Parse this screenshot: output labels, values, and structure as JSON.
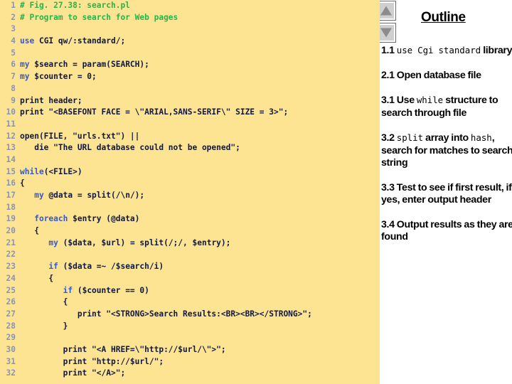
{
  "code_panel": {
    "language": "perl",
    "lines": [
      {
        "num": "1",
        "tokens": [
          {
            "t": "# Fig. 27.38: search.pl",
            "c": "comment"
          }
        ]
      },
      {
        "num": "2",
        "tokens": [
          {
            "t": "# Program to search for Web pages",
            "c": "comment"
          }
        ]
      },
      {
        "num": "3",
        "tokens": [
          {
            "t": "",
            "c": "plain"
          }
        ]
      },
      {
        "num": "4",
        "tokens": [
          {
            "t": "use",
            "c": "kw"
          },
          {
            "t": " CGI qw/:standard/;",
            "c": "plain"
          }
        ]
      },
      {
        "num": "5",
        "tokens": [
          {
            "t": "",
            "c": "plain"
          }
        ]
      },
      {
        "num": "6",
        "tokens": [
          {
            "t": "my",
            "c": "kw"
          },
          {
            "t": " $search = param(SEARCH);",
            "c": "plain"
          }
        ]
      },
      {
        "num": "7",
        "tokens": [
          {
            "t": "my",
            "c": "kw"
          },
          {
            "t": " $counter = 0;",
            "c": "plain"
          }
        ]
      },
      {
        "num": "8",
        "tokens": [
          {
            "t": "",
            "c": "plain"
          }
        ]
      },
      {
        "num": "9",
        "tokens": [
          {
            "t": "print header;",
            "c": "plain"
          }
        ]
      },
      {
        "num": "10",
        "tokens": [
          {
            "t": "print \"<BASEFONT FACE = \\\"ARIAL,SANS-SERIF\\\" SIZE = 3>\";",
            "c": "plain"
          }
        ]
      },
      {
        "num": "11",
        "tokens": [
          {
            "t": "",
            "c": "plain"
          }
        ]
      },
      {
        "num": "12",
        "tokens": [
          {
            "t": "open(FILE, \"urls.txt\") ||",
            "c": "plain"
          }
        ]
      },
      {
        "num": "13",
        "tokens": [
          {
            "t": "   die \"The URL database could not be opened\";",
            "c": "plain"
          }
        ]
      },
      {
        "num": "14",
        "tokens": [
          {
            "t": "",
            "c": "plain"
          }
        ]
      },
      {
        "num": "15",
        "tokens": [
          {
            "t": "while",
            "c": "kw"
          },
          {
            "t": "(<FILE>)",
            "c": "plain"
          }
        ]
      },
      {
        "num": "16",
        "tokens": [
          {
            "t": "{",
            "c": "plain"
          }
        ]
      },
      {
        "num": "17",
        "tokens": [
          {
            "t": "   ",
            "c": "plain"
          },
          {
            "t": "my",
            "c": "kw"
          },
          {
            "t": " @data = split(/\\n/);",
            "c": "plain"
          }
        ]
      },
      {
        "num": "18",
        "tokens": [
          {
            "t": "",
            "c": "plain"
          }
        ]
      },
      {
        "num": "19",
        "tokens": [
          {
            "t": "   ",
            "c": "plain"
          },
          {
            "t": "foreach",
            "c": "kw"
          },
          {
            "t": " $entry (@data)",
            "c": "plain"
          }
        ]
      },
      {
        "num": "20",
        "tokens": [
          {
            "t": "   {",
            "c": "plain"
          }
        ]
      },
      {
        "num": "21",
        "tokens": [
          {
            "t": "      ",
            "c": "plain"
          },
          {
            "t": "my",
            "c": "kw"
          },
          {
            "t": " ($data, $url) = split(/;/, $entry);",
            "c": "plain"
          }
        ]
      },
      {
        "num": "22",
        "tokens": [
          {
            "t": "",
            "c": "plain"
          }
        ]
      },
      {
        "num": "23",
        "tokens": [
          {
            "t": "      ",
            "c": "plain"
          },
          {
            "t": "if",
            "c": "kw"
          },
          {
            "t": " ($data =~ /$search/i)",
            "c": "plain"
          }
        ]
      },
      {
        "num": "24",
        "tokens": [
          {
            "t": "      {",
            "c": "plain"
          }
        ]
      },
      {
        "num": "25",
        "tokens": [
          {
            "t": "         ",
            "c": "plain"
          },
          {
            "t": "if",
            "c": "kw"
          },
          {
            "t": " ($counter == 0)",
            "c": "plain"
          }
        ]
      },
      {
        "num": "26",
        "tokens": [
          {
            "t": "         {",
            "c": "plain"
          }
        ]
      },
      {
        "num": "27",
        "tokens": [
          {
            "t": "            print \"<STRONG>Search Results:<BR><BR></STRONG>\";",
            "c": "plain"
          }
        ]
      },
      {
        "num": "28",
        "tokens": [
          {
            "t": "         }",
            "c": "plain"
          }
        ]
      },
      {
        "num": "29",
        "tokens": [
          {
            "t": "",
            "c": "plain"
          }
        ]
      },
      {
        "num": "30",
        "tokens": [
          {
            "t": "         print \"<A HREF=\\\"http://$url/\\\">\";",
            "c": "plain"
          }
        ]
      },
      {
        "num": "31",
        "tokens": [
          {
            "t": "         print \"http://$url/\";",
            "c": "plain"
          }
        ]
      },
      {
        "num": "32",
        "tokens": [
          {
            "t": "         print \"</A>\";",
            "c": "plain"
          }
        ]
      }
    ]
  },
  "outline_panel": {
    "title": "Outline",
    "scroll_up_icon": "triangle-up-icon",
    "scroll_down_icon": "triangle-down-icon",
    "items": [
      {
        "id": "1.1",
        "html": "1.1 <span class=\"mono\">use Cgi standard</span> library"
      },
      {
        "id": "2.1",
        "html": "2.1 Open database file"
      },
      {
        "id": "3.1",
        "html": "3.1 Use <span class=\"mono\">while</span> structure to search through file"
      },
      {
        "id": "3.2",
        "html": "3.2 <span class=\"mono\">split</span> array into <span class=\"mono\">hash</span>, search for matches to search string"
      },
      {
        "id": "3.3",
        "html": "3.3 Test to see if first result, if yes, enter output header"
      },
      {
        "id": "3.4",
        "html": "3.4 Output results as they are found"
      }
    ]
  },
  "colors": {
    "code_background": "#fce492",
    "outline_background": "#ffffff",
    "comment": "#2ab34a",
    "keyword": "#3457d5",
    "plain_code": "#101840",
    "line_number": "#8a93b0",
    "button_face": "#cfcfcf",
    "triangle": "#8c8c8c"
  }
}
